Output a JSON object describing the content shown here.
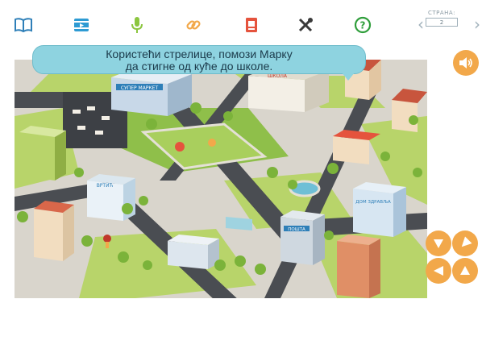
{
  "toolbar": {
    "icons": [
      "book-icon",
      "video-icon",
      "microphone-icon",
      "link-icon",
      "document-icon",
      "tools-icon",
      "help-icon"
    ],
    "page_label": "СТРАНА:",
    "page_number": "2",
    "prev": "‹",
    "next": "›"
  },
  "instruction": {
    "line1": "Користећи стрелице, помози Марку",
    "line2": "да стигне од куће до школе."
  },
  "map": {
    "signs": {
      "school": "ШКОЛА",
      "supermarket": "СУПЕР МАРКЕТ",
      "kindergarten": "ВРТИЋ",
      "post": "ПОШТА",
      "health": "ДОМ ЗДРАВЉА"
    }
  },
  "colors": {
    "accent": "#f2a84a",
    "bubble": "#8ed3e0",
    "toolbar_blue": "#2e7fb8",
    "toolbar_green": "#8cc63f",
    "toolbar_red": "#e5533d",
    "toolbar_orange": "#f2a84a"
  }
}
